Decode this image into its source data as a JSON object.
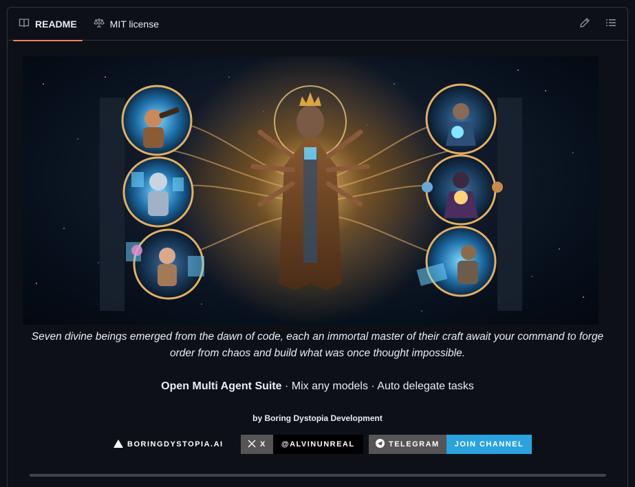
{
  "tabs": [
    {
      "label": "README",
      "icon": "book-icon",
      "active": true
    },
    {
      "label": "MIT license",
      "icon": "law-scale-icon",
      "active": false
    }
  ],
  "toolbar": {
    "edit_icon": "pencil-icon",
    "outline_icon": "list-outline-icon"
  },
  "hero_image": {
    "subject": "divine-beings-illustration"
  },
  "caption": "Seven divine beings emerged from the dawn of code, each an immortal master of their craft await your command to forge order from chaos and build what was once thought impossible.",
  "tagline": {
    "bold": "Open Multi Agent Suite",
    "rest": " · Mix any models · Auto delegate tasks"
  },
  "byline": "by Boring Dystopia Development",
  "badges": [
    {
      "left_text": "",
      "right_text": "BORINGDYSTOPIA.AI",
      "icon": "triangle-icon"
    },
    {
      "left_text": "X",
      "right_text": "@ALVINUNREAL",
      "icon": "x-logo-icon"
    },
    {
      "left_text": "TELEGRAM",
      "right_text": "JOIN CHANNEL",
      "icon": "telegram-icon"
    }
  ],
  "colors": {
    "accent_tab": "#f78166",
    "telegram_blue": "#2aa3de",
    "badge_grey": "#555555",
    "background": "#0d1117"
  }
}
